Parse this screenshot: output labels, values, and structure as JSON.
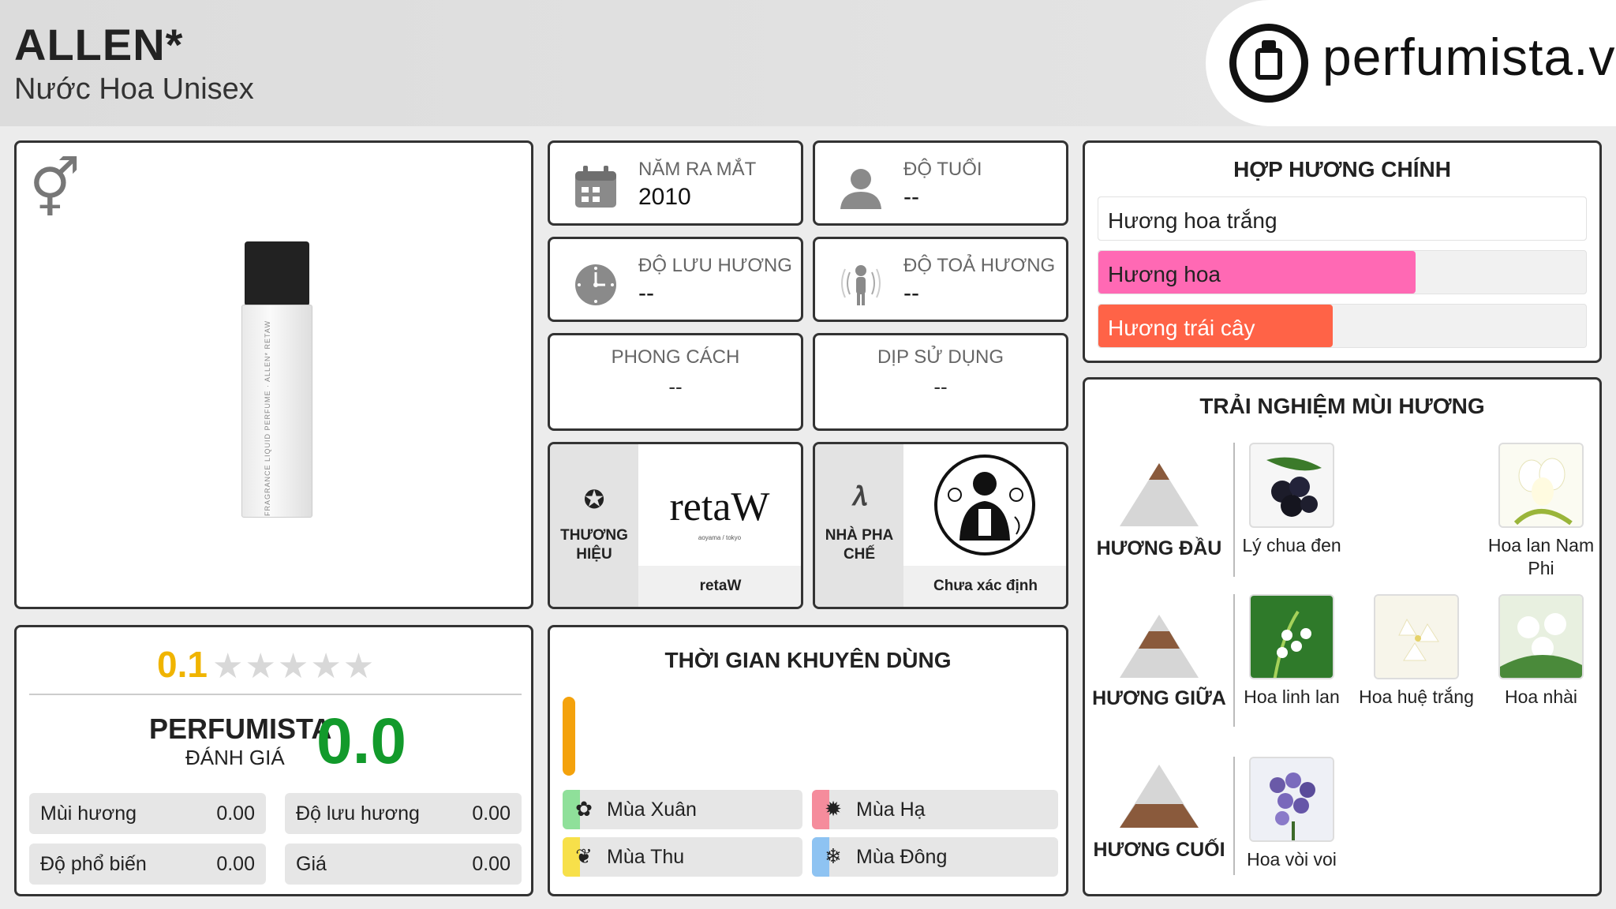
{
  "header": {
    "title": "ALLEN*",
    "subtitle": "Nước Hoa Unisex",
    "logo_text": "perfumista.vn"
  },
  "info": {
    "year_label": "NĂM RA MẮT",
    "year_value": "2010",
    "age_label": "ĐỘ TUỔI",
    "age_value": "--",
    "longevity_label": "ĐỘ LƯU HƯƠNG",
    "longevity_value": "--",
    "sillage_label": "ĐỘ TOẢ HƯƠNG",
    "sillage_value": "--",
    "style_label": "PHONG CÁCH",
    "style_value": "--",
    "occasion_label": "DỊP SỬ DỤNG",
    "occasion_value": "--"
  },
  "brand": {
    "label_1": "THƯƠNG",
    "label_2": "HIỆU",
    "logo_word": "retaW",
    "logo_sub": "aoyama / tokyo",
    "name": "retaW"
  },
  "perfumer": {
    "label_1": "NHÀ PHA",
    "label_2": "CHẾ",
    "name": "Chưa xác định"
  },
  "bottle_label": "FRAGRANCE LIQUID PERFUME · ALLEN* RETAW",
  "rating": {
    "score": "0.1",
    "stars": 0.02,
    "pf_label": "PERFUMISTA",
    "pf_sub": "ĐÁNH GIÁ",
    "pf_score": "0.0",
    "stats": [
      {
        "label": "Mùi hương",
        "value": "0.00"
      },
      {
        "label": "Độ lưu hương",
        "value": "0.00"
      },
      {
        "label": "Độ phổ biến",
        "value": "0.00"
      },
      {
        "label": "Giá",
        "value": "0.00"
      }
    ]
  },
  "time": {
    "title": "THỜI GIAN KHUYÊN DÙNG",
    "seasons": [
      {
        "label": "Mùa Xuân",
        "icon": "flower-icon",
        "color": "#8fe09a"
      },
      {
        "label": "Mùa Hạ",
        "icon": "sun-icon",
        "color": "#f58c9c"
      },
      {
        "label": "Mùa Thu",
        "icon": "leaf-icon",
        "color": "#f7e04a"
      },
      {
        "label": "Mùa Đông",
        "icon": "snowflake-icon",
        "color": "#8ec3f2"
      }
    ],
    "indicator_color": "#f4a20c"
  },
  "accords": {
    "title": "HỢP HƯƠNG CHÍNH",
    "items": [
      {
        "label": "Hương hoa trắng",
        "level": 1.0,
        "color": "#ffffff"
      },
      {
        "label": "Hương hoa",
        "level": 0.65,
        "color": "#ff69b4"
      },
      {
        "label": "Hương trái cây",
        "level": 0.48,
        "color": "#ff6347"
      }
    ]
  },
  "notes": {
    "title": "TRẢI NGHIỆM MÙI HƯƠNG",
    "top_label": "HƯƠNG ĐẦU",
    "mid_label": "HƯƠNG GIỮA",
    "base_label": "HƯƠNG CUỐI",
    "top": [
      "Lý chua đen",
      "Hoa lan Nam Phi"
    ],
    "mid": [
      "Hoa linh lan",
      "Hoa huệ trắng",
      "Hoa nhài"
    ],
    "base": [
      "Hoa vòi voi"
    ]
  }
}
